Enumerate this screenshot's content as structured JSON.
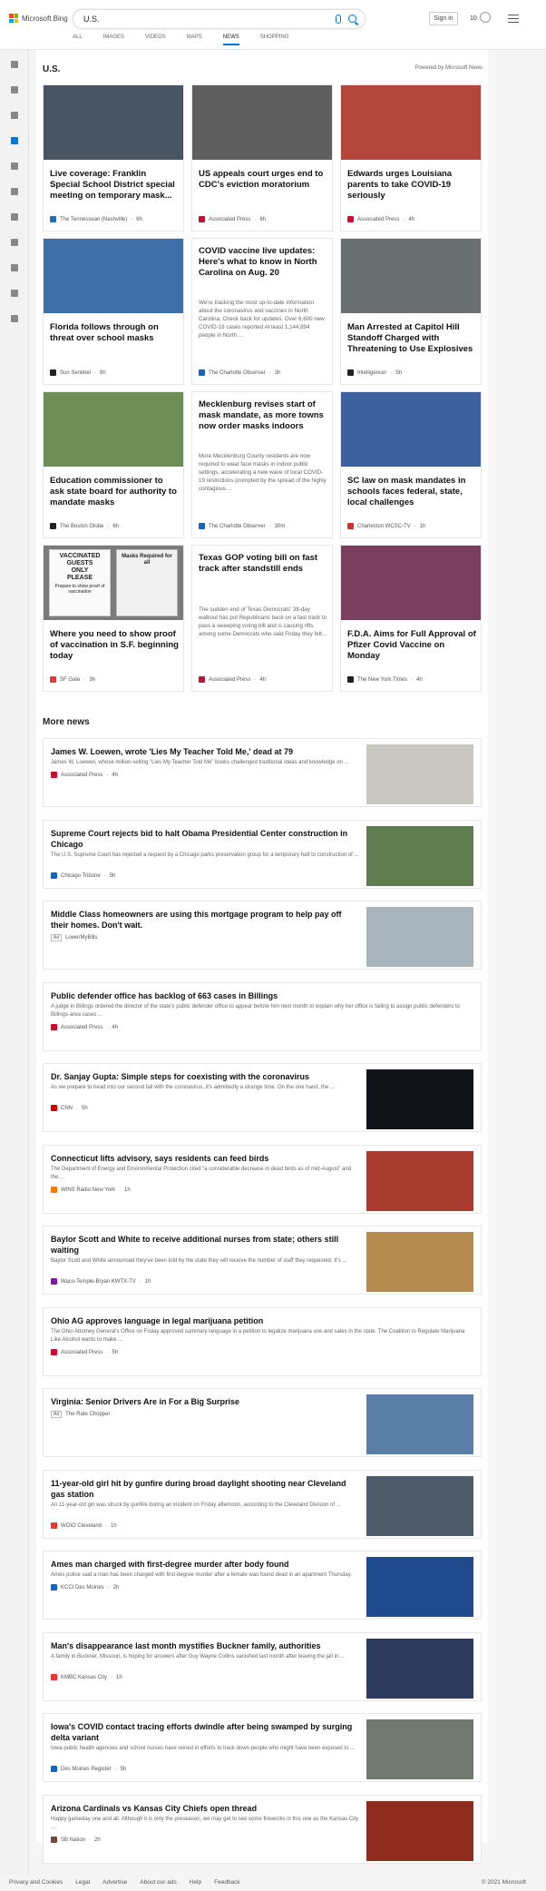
{
  "header": {
    "logo_text": "Microsoft Bing",
    "query": "U.S.",
    "signin_label": "Sign in",
    "rewards_count": "10",
    "tabs": [
      {
        "label": "ALL"
      },
      {
        "label": "IMAGES"
      },
      {
        "label": "VIDEOS"
      },
      {
        "label": "MAPS"
      },
      {
        "label": "NEWS"
      },
      {
        "label": "SHOPPING"
      }
    ]
  },
  "rail": {
    "icons": [
      "expand-icon",
      "home-icon",
      "shuffle-icon",
      "flag-icon",
      "location-icon",
      "globe-icon",
      "microscope-icon",
      "rocket-icon",
      "film-icon",
      "bank-icon",
      "health-icon"
    ]
  },
  "main": {
    "section_title": "U.S.",
    "powered_by": "Powered by Microsoft News",
    "cards": [
      {
        "title": "Live coverage: Franklin Special School District special meeting on temporary mask...",
        "snippet": "",
        "source": "The Tennessean (Nashville)",
        "time": "6h",
        "img_color": "#4a5563",
        "src_color": "#1f6fbf"
      },
      {
        "title": "US appeals court urges end to CDC's eviction moratorium",
        "snippet": "",
        "source": "Associated Press",
        "time": "8h",
        "img_color": "#5e5e5e",
        "src_color": "#c8102e"
      },
      {
        "title": "Edwards urges Louisiana parents to take COVID-19 seriously",
        "snippet": "",
        "source": "Associated Press",
        "time": "4h",
        "img_color": "#b4453a",
        "src_color": "#c8102e"
      },
      {
        "title": "Florida follows through on threat over school masks",
        "snippet": "",
        "source": "Sun Sentinel",
        "time": "8h",
        "img_color": "#3e6fa8",
        "src_color": "#222222"
      },
      {
        "title": "COVID vaccine live updates: Here's what to know in North Carolina on Aug. 20",
        "snippet": "We're tracking the most up-to-date information about the coronavirus and vaccines in North Carolina. Check back for updates. Over 6,600 new COVID-19 cases reported At least 1,144,894 people in North ...",
        "source": "The Charlotte Observer",
        "time": "3h",
        "img_color": "",
        "src_color": "#1565c0"
      },
      {
        "title": "Man Arrested at Capitol Hill Standoff Charged with Threatening to Use Explosives",
        "snippet": "",
        "source": "Intelligencer",
        "time": "5h",
        "img_color": "#6a6f72",
        "src_color": "#222222"
      },
      {
        "title": "Education commissioner to ask state board for authority to mandate masks",
        "snippet": "",
        "source": "The Boston Globe",
        "time": "6h",
        "img_color": "#6d8e57",
        "src_color": "#222222"
      },
      {
        "title": "Mecklenburg revises start of mask mandate, as more towns now order masks indoors",
        "snippet": "More Mecklenburg County residents are now required to wear face masks in indoor public settings, accelerating a new wave of local COVID-19 restrictions prompted by the spread of the highly contagious ...",
        "source": "The Charlotte Observer",
        "time": "30m",
        "img_color": "",
        "src_color": "#1565c0"
      },
      {
        "title": "SC law on mask mandates in schools faces federal, state, local challenges",
        "snippet": "",
        "source": "Charleston WCSC-TV",
        "time": "1h",
        "img_color": "#3e5fa0",
        "src_color": "#d32f2f"
      },
      {
        "title": "Where you need to show proof of vaccination in S.F. beginning today",
        "snippet": "",
        "source": "SF Gate",
        "time": "3h",
        "img_color": "#8a8a8a",
        "src_color": "#e53935"
      },
      {
        "title": "Texas GOP voting bill on fast track after standstill ends",
        "snippet": "The sudden end of Texas Democrats' 38-day walkout has put Republicans back on a fast track to pass a sweeping voting bill and is causing rifts among some Democrats who said Friday they felt...",
        "source": "Associated Press",
        "time": "4h",
        "img_color": "",
        "src_color": "#c8102e"
      },
      {
        "title": "F.D.A. Aims for Full Approval of Pfizer Covid Vaccine on Monday",
        "snippet": "",
        "source": "The New York Times",
        "time": "4h",
        "img_color": "#7a3e5e",
        "src_color": "#222222"
      }
    ],
    "sign_text": {
      "line1": "VACCINATED",
      "line2": "GUESTS",
      "line3": "ONLY",
      "line4": "PLEASE",
      "line5": "Prepare to show proof of vaccination",
      "line6": "Masks Required for all"
    },
    "more_news_title": "More news",
    "more_news": [
      {
        "title": "James W. Loewen, wrote 'Lies My Teacher Told Me,' dead at 79",
        "snippet": "James W. Loewen, whose million-selling \"Lies My Teacher Told Me\" books challenged traditional ideas and knowledge on ...",
        "source": "Associated Press",
        "time": "4h",
        "thumb_color": "#c8c8c0",
        "src_color": "#c8102e"
      },
      {
        "title": "Supreme Court rejects bid to halt Obama Presidential Center construction in Chicago",
        "snippet": "The U.S. Supreme Court has rejected a request by a Chicago parks preservation group for a temporary halt to construction of ...",
        "source": "Chicago Tribune",
        "time": "5h",
        "thumb_color": "#5f7d4f",
        "src_color": "#1565c0"
      },
      {
        "title": "Middle Class homeowners are using this mortgage program to help pay off their homes. Don't wait.",
        "snippet": "",
        "source": "LowerMyBills",
        "time": "",
        "ad": "Ad",
        "thumb_color": "#a9b5bd",
        "src_color": ""
      },
      {
        "title": "Public defender office has backlog of 663 cases in Billings",
        "snippet": "A judge in Billings ordered the director of the state's public defender office to appear before him next month to explain why her office is failing to assign public defenders to Billings-area cases ...",
        "source": "Associated Press",
        "time": "4h",
        "thumb_color": "",
        "src_color": "#c8102e"
      },
      {
        "title": "Dr. Sanjay Gupta: Simple steps for coexisting with the coronavirus",
        "snippet": "As we prepare to head into our second fall with the coronavirus, it's admittedly a strange time. On the one hand, the ...",
        "source": "CNN",
        "time": "5h",
        "thumb_color": "#101418",
        "src_color": "#cc0000"
      },
      {
        "title": "Connecticut lifts advisory, says residents can feed birds",
        "snippet": "The Department of Energy and Environmental Protection cited \"a considerable decrease in dead birds as of mid-August\" and the ...",
        "source": "WINS Radio New York",
        "time": "1h",
        "thumb_color": "#a83a2e",
        "src_color": "#f57c00"
      },
      {
        "title": "Baylor Scott and White to receive additional nurses from state; others still waiting",
        "snippet": "Baylor Scott and White announced they've been told by the state they will receive the number of staff they requested. It's ...",
        "source": "Waco-Temple-Bryan KWTX-TV",
        "time": "1h",
        "thumb_color": "#b58a4e",
        "src_color": "#7b1fa2"
      },
      {
        "title": "Ohio AG approves language in legal marijuana petition",
        "snippet": "The Ohio Attorney General's Office on Friday approved summary language in a petition to legalize marijuana use and sales in the state. The Coalition to Regulate Marijuana Like Alcohol wants to make ...",
        "source": "Associated Press",
        "time": "5h",
        "thumb_color": "",
        "src_color": "#c8102e"
      },
      {
        "title": "Virginia: Senior Drivers Are in For a Big Surprise",
        "snippet": "",
        "source": "The Rate Chopper",
        "time": "",
        "ad": "Ad",
        "thumb_color": "#5a7ea6",
        "src_color": ""
      },
      {
        "title": "11-year-old girl hit by gunfire during broad daylight shooting near Cleveland gas station",
        "snippet": "An 11-year-old girl was struck by gunfire during an incident on Friday afternoon, according to the Cleveland Division of ...",
        "source": "WOIO Cleveland",
        "time": "1h",
        "thumb_color": "#4d5a68",
        "src_color": "#e53935"
      },
      {
        "title": "Ames man charged with first-degree murder after body found",
        "snippet": "Ames police said a man has been charged with first-degree murder after a female was found dead in an apartment Thursday.",
        "source": "KCCI Des Moines",
        "time": "2h",
        "thumb_color": "#1f4b8e",
        "src_color": "#1565c0"
      },
      {
        "title": "Man's disappearance last month mystifies Buckner family, authorities",
        "snippet": "A family in Buckner, Missouri, is hoping for answers after Guy Wayne Collins vanished last month after leaving the jail in ...",
        "source": "KMBC Kansas City",
        "time": "1h",
        "thumb_color": "#2e3a5e",
        "src_color": "#e53935"
      },
      {
        "title": "Iowa's COVID contact tracing efforts dwindle after being swamped by surging delta variant",
        "snippet": "Iowa public health agencies and school nurses have reined in efforts to track down people who might have been exposed to ...",
        "source": "Des Moines Register",
        "time": "5h",
        "thumb_color": "#707a6e",
        "src_color": "#1565c0"
      },
      {
        "title": "Arizona Cardinals vs Kansas City Chiefs open thread",
        "snippet": "Happy gameday one and all. Although it is only the preseason, we may get to see some fireworks in this one as the Kansas City ...",
        "source": "SB Nation",
        "time": "2h",
        "thumb_color": "#8e2a1e",
        "src_color": "#6d4c41"
      }
    ]
  },
  "footer": {
    "links": [
      "Privacy and Cookies",
      "Legal",
      "Advertise",
      "About our ads",
      "Help",
      "Feedback"
    ],
    "copyright": "© 2021 Microsoft"
  }
}
